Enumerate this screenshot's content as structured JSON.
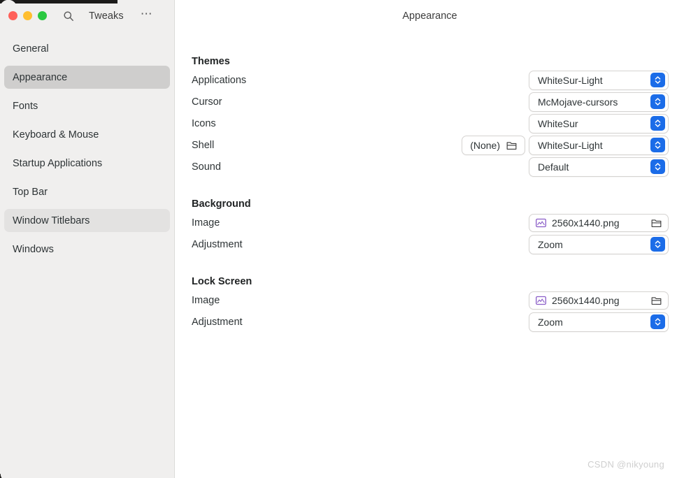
{
  "window": {
    "app_name": "Tweaks",
    "page_title": "Appearance",
    "traffic_lights": [
      {
        "name": "close",
        "color": "#ff6059"
      },
      {
        "name": "minimize",
        "color": "#ffbe2f"
      },
      {
        "name": "maximize",
        "color": "#2ac840"
      }
    ],
    "search_icon": "search-icon",
    "menu_icon": "ellipsis-menu-icon",
    "menu_label": "⋯"
  },
  "sidebar": {
    "items": [
      {
        "label": "General",
        "state": "normal"
      },
      {
        "label": "Appearance",
        "state": "selected"
      },
      {
        "label": "Fonts",
        "state": "normal"
      },
      {
        "label": "Keyboard & Mouse",
        "state": "normal"
      },
      {
        "label": "Startup Applications",
        "state": "normal"
      },
      {
        "label": "Top Bar",
        "state": "normal"
      },
      {
        "label": "Window Titlebars",
        "state": "hovered"
      },
      {
        "label": "Windows",
        "state": "normal"
      }
    ]
  },
  "sections": {
    "themes": {
      "title": "Themes",
      "rows": [
        {
          "label": "Applications",
          "value": "WhiteSur-Light"
        },
        {
          "label": "Cursor",
          "value": "McMojave-cursors"
        },
        {
          "label": "Icons",
          "value": "WhiteSur"
        },
        {
          "label": "Shell",
          "value": "WhiteSur-Light",
          "extra_button": "(None)"
        },
        {
          "label": "Sound",
          "value": "Default"
        }
      ]
    },
    "background": {
      "title": "Background",
      "image_label": "Image",
      "image_value": "2560x1440.png",
      "adjustment_label": "Adjustment",
      "adjustment_value": "Zoom"
    },
    "lockscreen": {
      "title": "Lock Screen",
      "image_label": "Image",
      "image_value": "2560x1440.png",
      "adjustment_label": "Adjustment",
      "adjustment_value": "Zoom"
    }
  },
  "watermark": "CSDN @nikyoung",
  "colors": {
    "accent": "#1b6ce8",
    "sidebar_bg": "#f0efee",
    "selected_bg": "#cfcecd",
    "hover_bg": "#e3e2e1",
    "image_icon": "#8b5ec8"
  }
}
